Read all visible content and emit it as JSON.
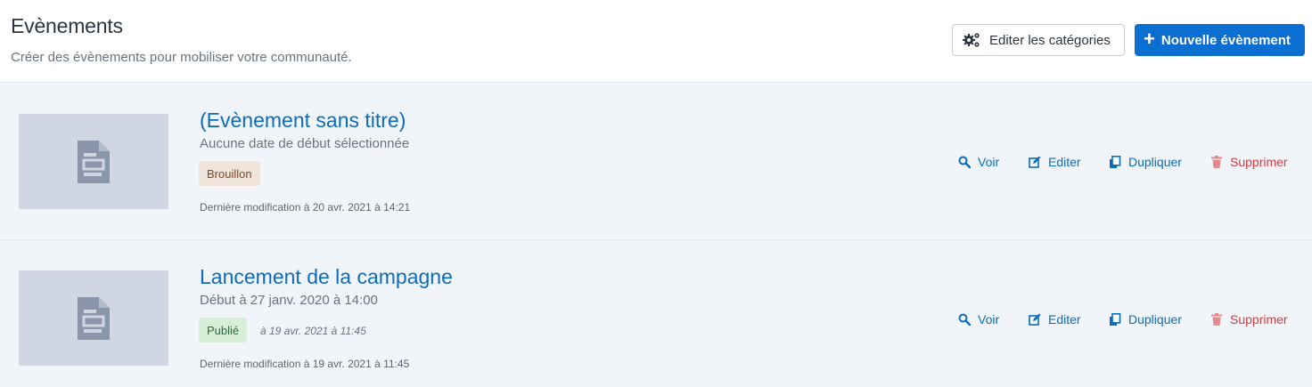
{
  "header": {
    "title": "Evènements",
    "subtitle": "Créer des évènements pour mobiliser votre communauté.",
    "edit_categories_label": "Editer les catégories",
    "new_event_label": "Nouvelle évènement"
  },
  "actions": {
    "view": "Voir",
    "edit": "Editer",
    "duplicate": "Dupliquer",
    "delete": "Supprimer"
  },
  "events": [
    {
      "title": "(Evènement sans titre)",
      "date": "Aucune date de début sélectionnée",
      "status": "Brouillon",
      "published_at": "",
      "modified": "Dernière modification à 20 avr. 2021 à 14:21"
    },
    {
      "title": "Lancement de la campagne",
      "date": "Début à 27 janv. 2020 à 14:00",
      "status": "Publié",
      "published_at": "à 19 avr. 2021 à 11:45",
      "modified": "Dernière modification à 19 avr. 2021 à 11:45"
    }
  ],
  "colors": {
    "primary": "#0a6fd1",
    "link": "#0b6cb8",
    "danger": "#d23a3f",
    "draft_badge_bg": "#f0e4da",
    "published_badge_bg": "#d7eed8",
    "thumbnail_bg": "#d0d6e2"
  },
  "icons": {
    "edit_categories": "gears-icon",
    "new_event": "plus-icon",
    "thumbnail": "document-icon",
    "view": "search-icon",
    "edit": "pencil-icon",
    "duplicate": "copy-icon",
    "delete": "trash-icon"
  }
}
